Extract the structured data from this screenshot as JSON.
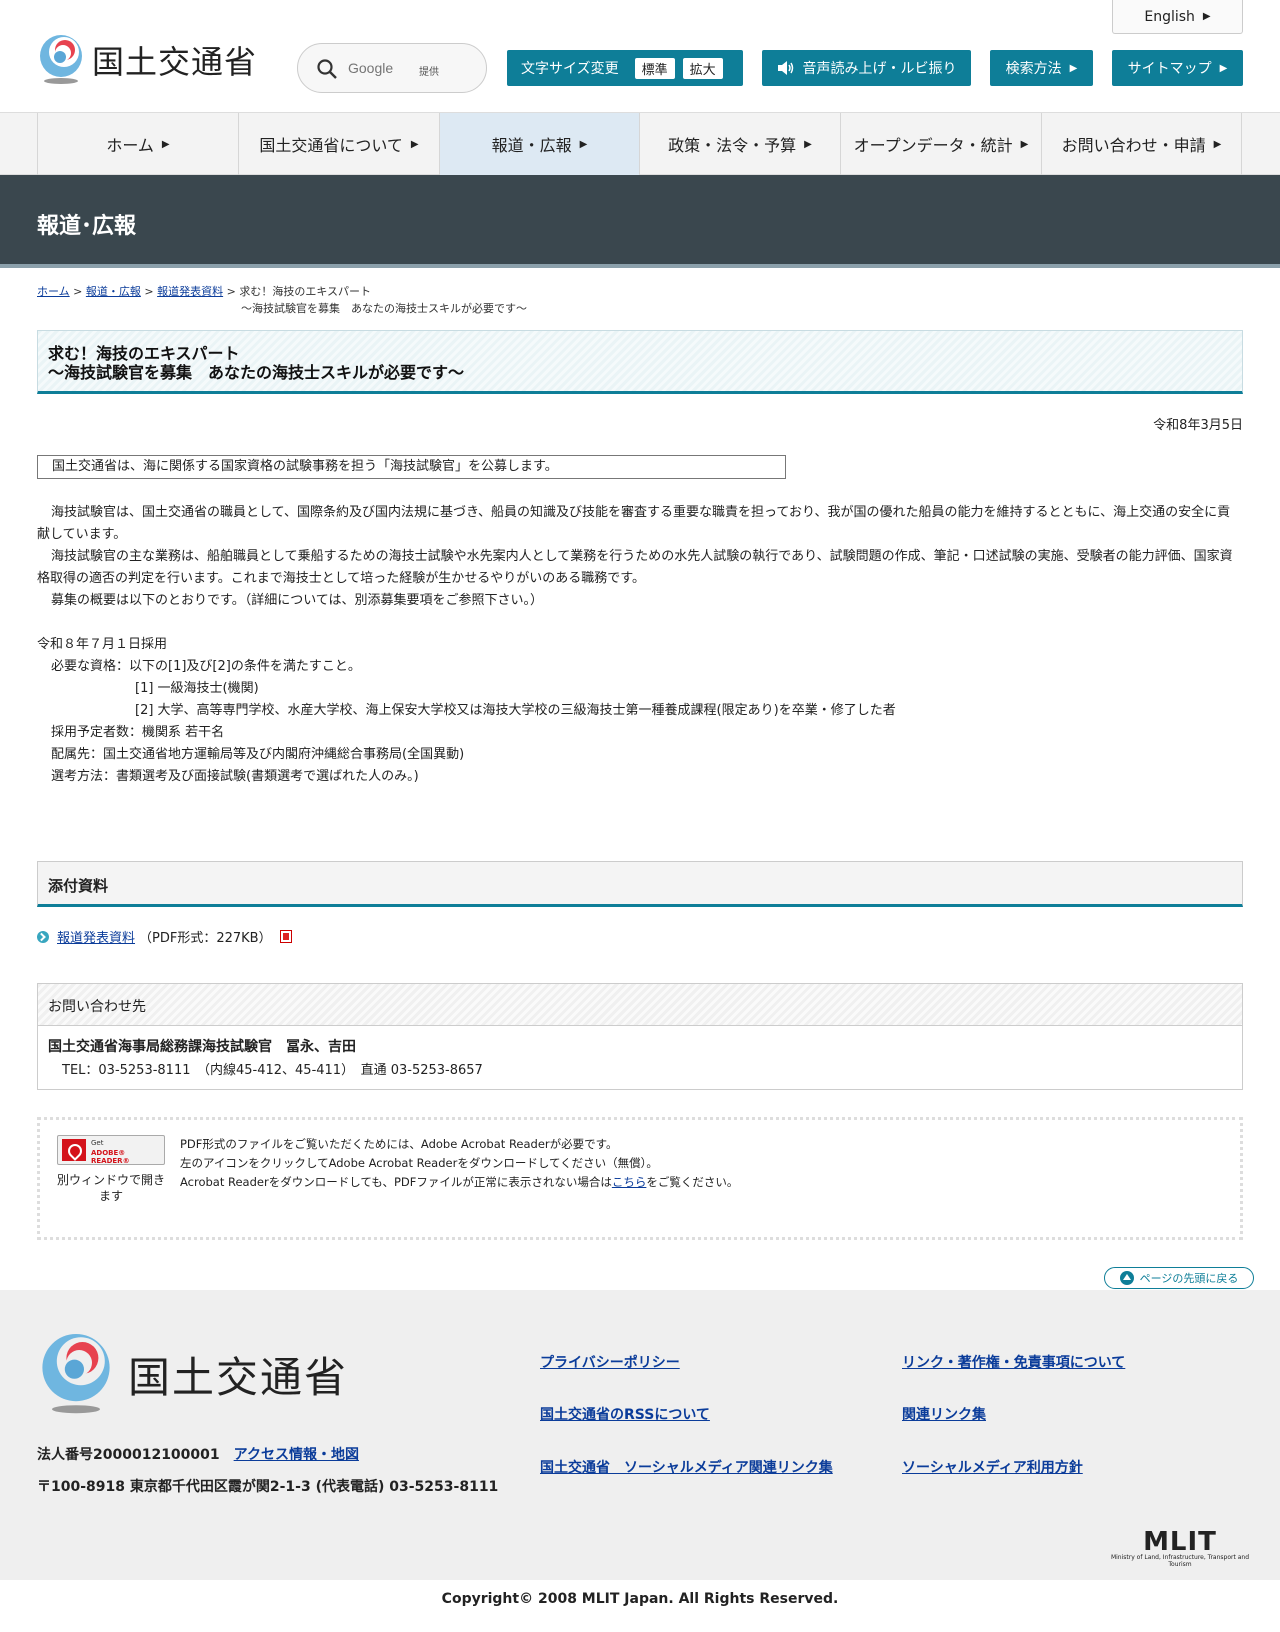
{
  "header": {
    "logo_text": "国土交通省",
    "search": {
      "placeholder": "Google",
      "provider": "提供"
    },
    "font_size": {
      "label": "文字サイズ変更",
      "standard": "標準",
      "large": "拡大"
    },
    "voice_label": "音声読み上げ・ルビ振り",
    "search_method_label": "検索方法",
    "sitemap_label": "サイトマップ",
    "english_label": "English"
  },
  "gnav": {
    "items": [
      {
        "label": "ホーム"
      },
      {
        "label": "国土交通省について"
      },
      {
        "label": "報道・広報"
      },
      {
        "label": "政策・法令・予算"
      },
      {
        "label": "オープンデータ・統計"
      },
      {
        "label": "お問い合わせ・申請"
      }
    ]
  },
  "band_title": "報道･広報",
  "breadcrumb": {
    "home": "ホーム",
    "press": "報道・広報",
    "releases": "報道発表資料",
    "current_line1": "求む！海技のエキスパート",
    "current_line2": "～海技試験官を募集　あなたの海技士スキルが必要です～"
  },
  "article": {
    "title_line1": "求む！海技のエキスパート",
    "title_line2": "～海技試験官を募集　あなたの海技士スキルが必要です～",
    "date": "令和8年3月5日",
    "summary": "国土交通省は、海に関係する国家資格の試験事務を担う「海技試験官」を公募します。",
    "para1": "海技試験官は、国土交通省の職員として、国際条約及び国内法規に基づき、船員の知識及び技能を審査する重要な職責を担っており、我が国の優れた船員の能力を維持するとともに、海上交通の安全に貢献しています。",
    "para2": "海技試験官の主な業務は、船舶職員として乗船するための海技士試験や水先案内人として業務を行うための水先人試験の執行であり、試験問題の作成、筆記・口述試験の実施、受験者の能力評価、国家資格取得の適否の判定を行います。これまで海技士として培った経験が生かせるやりがいのある職務です。",
    "para3": "募集の概要は以下のとおりです。（詳細については、別添募集要項をご参照下さい。）",
    "recruit": {
      "hire_date": "令和８年７月１日採用",
      "qual": "必要な資格：以下の[1]及び[2]の条件を満たすこと。",
      "qual1": "[1] 一級海技士(機関)",
      "qual2": "[2] 大学、高等専門学校、水産大学校、海上保安大学校又は海技大学校の三級海技士第一種養成課程(限定あり)を卒業・修了した者",
      "count": "採用予定者数：機関系 若干名",
      "assignment": "配属先：国土交通省地方運輸局等及び内閣府沖縄総合事務局(全国異動)",
      "method": "選考方法：書類選考及び面接試験(書類選考で選ばれた人のみ。)"
    }
  },
  "attachments": {
    "heading": "添付資料",
    "items": [
      {
        "label": "報道発表資料",
        "meta": "（PDF形式：227KB）"
      }
    ]
  },
  "contact": {
    "heading": "お問い合わせ先",
    "name": "国土交通省海事局総務課海技試験官　冨永、吉田",
    "tel": "TEL：03-5253-8111　（内線45-412、45-411）　直通 03-5253-8657"
  },
  "adobe": {
    "get": "Get",
    "reader": "ADOBE® READER®",
    "new_window": "別ウィンドウで開きます",
    "line1": "PDF形式のファイルをご覧いただくためには、Adobe Acrobat Readerが必要です。",
    "line2": "左のアイコンをクリックしてAdobe Acrobat Readerをダウンロードしてください（無償）。",
    "line3_pre": "Acrobat Readerをダウンロードしても、PDFファイルが正常に表示されない場合は",
    "line3_link": "こちら",
    "line3_post": "をご覧ください。"
  },
  "page_top_label": "ページの先頭に戻る",
  "footer": {
    "logo_text": "国土交通省",
    "corp_no": "法人番号2000012100001",
    "access_link": "アクセス情報・地図",
    "address": "〒100-8918 東京都千代田区霞が関2-1-3 (代表電話) 03-5253-8111",
    "links": [
      "プライバシーポリシー",
      "リンク・著作権・免責事項について",
      "国土交通省のRSSについて",
      "関連リンク集",
      "国土交通省　ソーシャルメディア関連リンク集",
      "ソーシャルメディア利用方針"
    ],
    "mlit_word": "MLIT",
    "mlit_sub": "Ministry of Land, Infrastructure, Transport and Tourism",
    "copyright": "Copyright© 2008 MLIT Japan. All Rights Reserved."
  },
  "colors": {
    "accent": "#0e7e98",
    "band": "#3a474e",
    "nav_active": "#dde9f3",
    "link": "#0b3c9a"
  }
}
